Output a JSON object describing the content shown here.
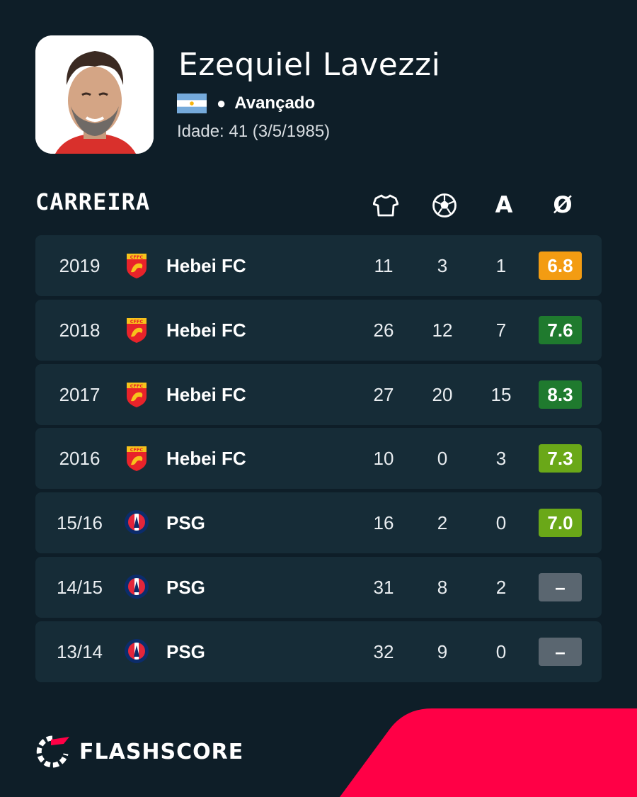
{
  "player": {
    "name": "Ezequiel Lavezzi",
    "position": "Avançado",
    "age_text": "Idade: 41  (3/5/1985)",
    "flag_icon": "argentina-flag-icon"
  },
  "career": {
    "title": "CARREIRA",
    "columns": [
      {
        "icon": "jersey-icon"
      },
      {
        "icon": "football-icon"
      },
      {
        "label": "A"
      },
      {
        "label": "Ø"
      }
    ],
    "rows": [
      {
        "season": "2019",
        "team": "Hebei FC",
        "logo": "hebei-fc-logo",
        "apps": "11",
        "goals": "3",
        "assists": "1",
        "rating": "6.8",
        "rating_color": "#f39c12"
      },
      {
        "season": "2018",
        "team": "Hebei FC",
        "logo": "hebei-fc-logo",
        "apps": "26",
        "goals": "12",
        "assists": "7",
        "rating": "7.6",
        "rating_color": "#1f7a2e"
      },
      {
        "season": "2017",
        "team": "Hebei FC",
        "logo": "hebei-fc-logo",
        "apps": "27",
        "goals": "20",
        "assists": "15",
        "rating": "8.3",
        "rating_color": "#1f7a2e"
      },
      {
        "season": "2016",
        "team": "Hebei FC",
        "logo": "hebei-fc-logo",
        "apps": "10",
        "goals": "0",
        "assists": "3",
        "rating": "7.3",
        "rating_color": "#6aa818"
      },
      {
        "season": "15/16",
        "team": "PSG",
        "logo": "psg-logo",
        "apps": "16",
        "goals": "2",
        "assists": "0",
        "rating": "7.0",
        "rating_color": "#6aa818"
      },
      {
        "season": "14/15",
        "team": "PSG",
        "logo": "psg-logo",
        "apps": "31",
        "goals": "8",
        "assists": "2",
        "rating": "–",
        "rating_color": "#5a6670"
      },
      {
        "season": "13/14",
        "team": "PSG",
        "logo": "psg-logo",
        "apps": "32",
        "goals": "9",
        "assists": "0",
        "rating": "–",
        "rating_color": "#5a6670"
      }
    ]
  },
  "brand": {
    "name": "FLASHSCORE",
    "accent": "#ff0046"
  }
}
